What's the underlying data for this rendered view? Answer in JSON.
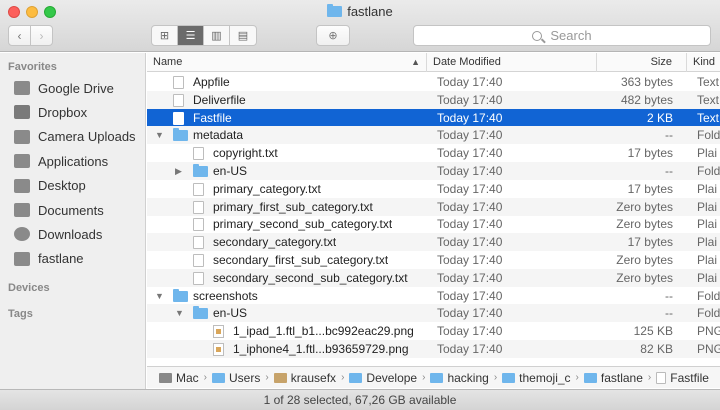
{
  "window": {
    "title": "fastlane"
  },
  "toolbar": {
    "back_glyph": "‹",
    "forward_glyph": "›",
    "view_icons": [
      "⊞",
      "☰",
      "▥",
      "▤"
    ],
    "action_glyph": "⊕",
    "search_placeholder": "Search"
  },
  "sidebar": {
    "favorites_label": "Favorites",
    "items": [
      {
        "label": "Google Drive",
        "icon": "drive-icon"
      },
      {
        "label": "Dropbox",
        "icon": "dropbox-icon"
      },
      {
        "label": "Camera Uploads",
        "icon": "folder-icon"
      },
      {
        "label": "Applications",
        "icon": "applications-icon"
      },
      {
        "label": "Desktop",
        "icon": "desktop-icon"
      },
      {
        "label": "Documents",
        "icon": "documents-icon"
      },
      {
        "label": "Downloads",
        "icon": "downloads-icon"
      },
      {
        "label": "fastlane",
        "icon": "folder-icon"
      }
    ],
    "devices_label": "Devices",
    "tags_label": "Tags"
  },
  "columns": {
    "name": "Name",
    "date": "Date Modified",
    "size": "Size",
    "kind": "Kind"
  },
  "rows": [
    {
      "name": "Appfile",
      "date": "Today 17:40",
      "size": "363 bytes",
      "kind": "Text",
      "type": "file",
      "depth": 0,
      "disclosure": ""
    },
    {
      "name": "Deliverfile",
      "date": "Today 17:40",
      "size": "482 bytes",
      "kind": "Text",
      "type": "file",
      "depth": 0,
      "disclosure": ""
    },
    {
      "name": "Fastfile",
      "date": "Today 17:40",
      "size": "2 KB",
      "kind": "Text",
      "type": "file",
      "depth": 0,
      "disclosure": "",
      "selected": true
    },
    {
      "name": "metadata",
      "date": "Today 17:40",
      "size": "--",
      "kind": "Fold",
      "type": "folder",
      "depth": 0,
      "disclosure": "▼"
    },
    {
      "name": "copyright.txt",
      "date": "Today 17:40",
      "size": "17 bytes",
      "kind": "Plai",
      "type": "file",
      "depth": 1,
      "disclosure": ""
    },
    {
      "name": "en-US",
      "date": "Today 17:40",
      "size": "--",
      "kind": "Fold",
      "type": "folder",
      "depth": 1,
      "disclosure": "▶"
    },
    {
      "name": "primary_category.txt",
      "date": "Today 17:40",
      "size": "17 bytes",
      "kind": "Plai",
      "type": "file",
      "depth": 1,
      "disclosure": ""
    },
    {
      "name": "primary_first_sub_category.txt",
      "date": "Today 17:40",
      "size": "Zero bytes",
      "kind": "Plai",
      "type": "file",
      "depth": 1,
      "disclosure": ""
    },
    {
      "name": "primary_second_sub_category.txt",
      "date": "Today 17:40",
      "size": "Zero bytes",
      "kind": "Plai",
      "type": "file",
      "depth": 1,
      "disclosure": ""
    },
    {
      "name": "secondary_category.txt",
      "date": "Today 17:40",
      "size": "17 bytes",
      "kind": "Plai",
      "type": "file",
      "depth": 1,
      "disclosure": ""
    },
    {
      "name": "secondary_first_sub_category.txt",
      "date": "Today 17:40",
      "size": "Zero bytes",
      "kind": "Plai",
      "type": "file",
      "depth": 1,
      "disclosure": ""
    },
    {
      "name": "secondary_second_sub_category.txt",
      "date": "Today 17:40",
      "size": "Zero bytes",
      "kind": "Plai",
      "type": "file",
      "depth": 1,
      "disclosure": ""
    },
    {
      "name": "screenshots",
      "date": "Today 17:40",
      "size": "--",
      "kind": "Fold",
      "type": "folder",
      "depth": 0,
      "disclosure": "▼"
    },
    {
      "name": "en-US",
      "date": "Today 17:40",
      "size": "--",
      "kind": "Fold",
      "type": "folder",
      "depth": 1,
      "disclosure": "▼"
    },
    {
      "name": "1_ipad_1.ftl_b1...bc992eac29.png",
      "date": "Today 17:40",
      "size": "125 KB",
      "kind": "PNG",
      "type": "image",
      "depth": 2,
      "disclosure": ""
    },
    {
      "name": "1_iphone4_1.ftl...b93659729.png",
      "date": "Today 17:40",
      "size": "82 KB",
      "kind": "PNG",
      "type": "image",
      "depth": 2,
      "disclosure": ""
    }
  ],
  "pathbar": [
    {
      "label": "Mac",
      "icon": "mac"
    },
    {
      "label": "Users",
      "icon": "folder"
    },
    {
      "label": "krausefx",
      "icon": "home"
    },
    {
      "label": "Develope",
      "icon": "folder"
    },
    {
      "label": "hacking",
      "icon": "folder"
    },
    {
      "label": "themoji_c",
      "icon": "folder"
    },
    {
      "label": "fastlane",
      "icon": "folder"
    },
    {
      "label": "Fastfile",
      "icon": "file"
    }
  ],
  "status": {
    "text": "1 of 28 selected, 67,26 GB available"
  },
  "colors": {
    "selection": "#1164d4",
    "folder": "#6fb6ec",
    "sidebar_bg": "#efefef"
  }
}
